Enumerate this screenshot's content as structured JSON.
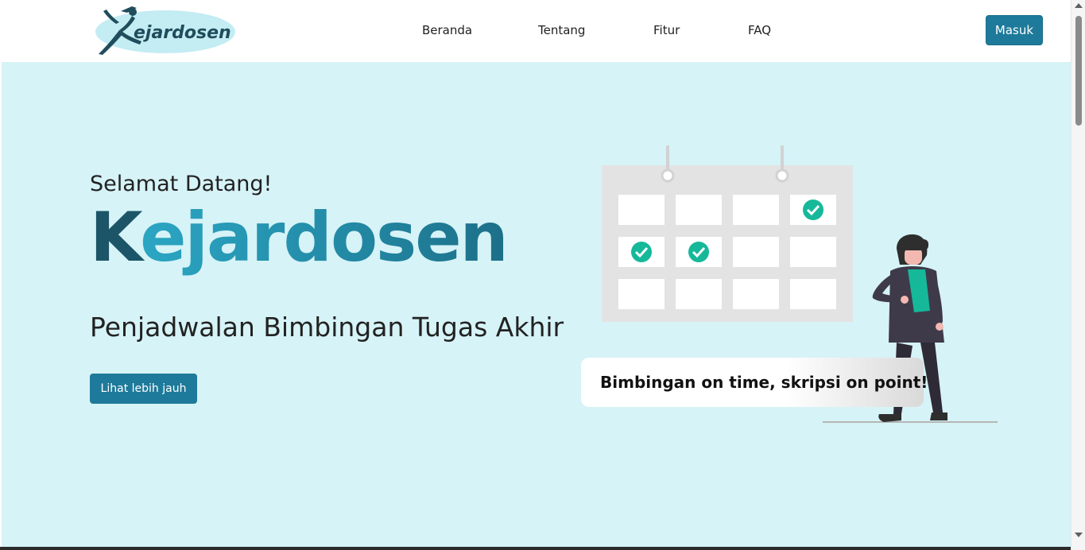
{
  "header": {
    "logo_text": "Kejardosen",
    "nav": [
      {
        "label": "Beranda"
      },
      {
        "label": "Tentang"
      },
      {
        "label": "Fitur"
      },
      {
        "label": "FAQ"
      }
    ],
    "login_label": "Masuk"
  },
  "hero": {
    "greeting": "Selamat Datang!",
    "brand_first": "K",
    "brand_rest": "ejardosen",
    "tagline": "Penjadwalan Bimbingan Tugas Akhir",
    "cta_label": "Lihat lebih jauh",
    "quote": "Bimbingan on time, skripsi on point!"
  },
  "colors": {
    "primary": "#1e7a9a",
    "hero_bg": "#d6f3f7",
    "brand_dark": "#1c5568",
    "check_green": "#16b89a"
  }
}
